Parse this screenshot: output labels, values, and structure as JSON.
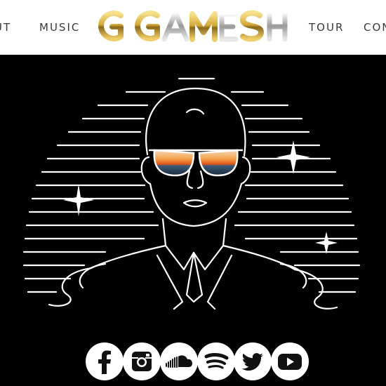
{
  "nav": {
    "about_partial": "UT",
    "music": "MUSIC",
    "tour": "TOUR",
    "contact_partial": "CON"
  },
  "logo": {
    "text": "GIGAMESH",
    "color": "#D4A93B"
  },
  "hero": {
    "background": "#000000",
    "line_color": "#FFFFFF"
  },
  "social": {
    "items": [
      {
        "name": "facebook",
        "icon": "facebook-icon"
      },
      {
        "name": "instagram",
        "icon": "instagram-icon"
      },
      {
        "name": "soundcloud",
        "icon": "soundcloud-icon"
      },
      {
        "name": "spotify",
        "icon": "spotify-icon"
      },
      {
        "name": "twitter",
        "icon": "twitter-icon"
      },
      {
        "name": "youtube",
        "icon": "youtube-icon"
      }
    ]
  }
}
